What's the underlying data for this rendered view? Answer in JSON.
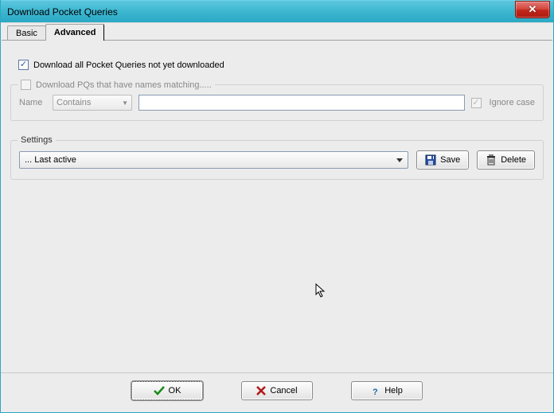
{
  "window": {
    "title": "Download Pocket Queries"
  },
  "tabs": {
    "basic": "Basic",
    "advanced": "Advanced",
    "active": "advanced"
  },
  "options": {
    "download_all_label": "Download all Pocket Queries not yet downloaded",
    "download_all_checked": true,
    "match_group_label": "Download PQs that have names matching.....",
    "match_checked": false,
    "name_label": "Name",
    "operator": "Contains",
    "pattern_value": "",
    "ignore_case_label": "Ignore case",
    "ignore_case_checked": true
  },
  "settings": {
    "legend": "Settings",
    "selected": "... Last active",
    "save_label": "Save",
    "delete_label": "Delete"
  },
  "buttons": {
    "ok": "OK",
    "cancel": "Cancel",
    "help": "Help"
  }
}
